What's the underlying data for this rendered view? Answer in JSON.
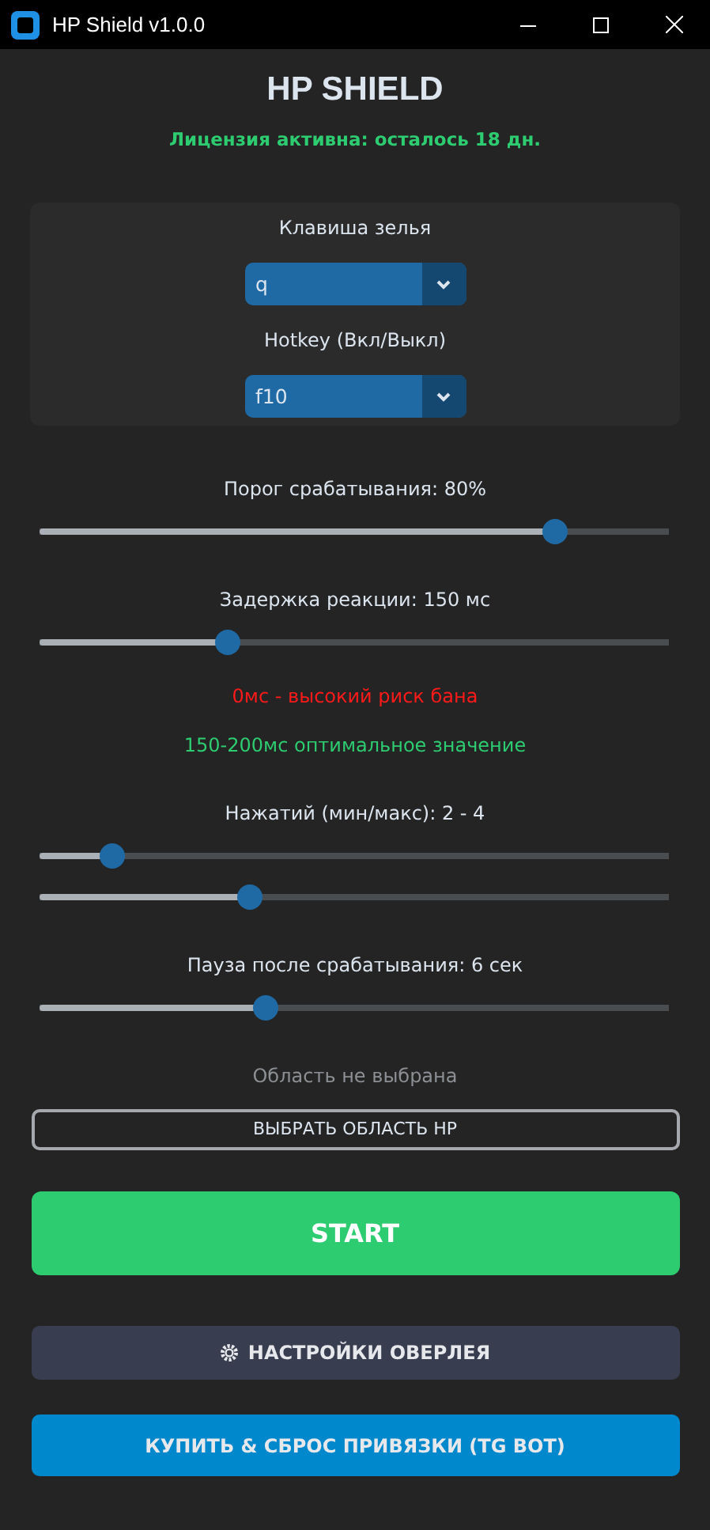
{
  "window": {
    "title": "HP Shield v1.0.0"
  },
  "header": {
    "title": "HP SHIELD",
    "license": "Лицензия активна: осталось 18 дн."
  },
  "panel": [
    {
      "label": "Клавиша зелья",
      "value": "q"
    },
    {
      "label": "Hotkey (Вкл/Выкл)",
      "value": "f10"
    }
  ],
  "settings": [
    {
      "kind": "slider",
      "label": "Порог срабатывания: 80%",
      "sliders": [
        {
          "level": 0.82
        }
      ]
    },
    {
      "kind": "slider",
      "label": "Задержка реакции: 150 мс",
      "sliders": [
        {
          "level": 0.3
        }
      ]
    },
    {
      "kind": "note",
      "text": "0мс - высокий риск бана",
      "color": "#ff1a1a"
    },
    {
      "kind": "note",
      "text": "150-200мс оптимальное значение",
      "color": "#2ecc71"
    },
    {
      "kind": "slider",
      "label": "Нажатий (мин/макс): 2 - 4",
      "sliders": [
        {
          "level": 0.115
        },
        {
          "level": 0.335
        }
      ]
    },
    {
      "kind": "slider",
      "label": "Пауза после срабатывания: 6 сек",
      "sliders": [
        {
          "level": 0.36
        }
      ]
    }
  ],
  "area": {
    "status": "Область не выбрана",
    "button": "ВЫБРАТЬ ОБЛАСТЬ HP"
  },
  "start_button": "START",
  "overlay_button": "НАСТРОЙКИ ОВЕРЛЕЯ",
  "buy_button": "КУПИТЬ & СБРОС ПРИВЯЗКИ (TG BOT)"
}
